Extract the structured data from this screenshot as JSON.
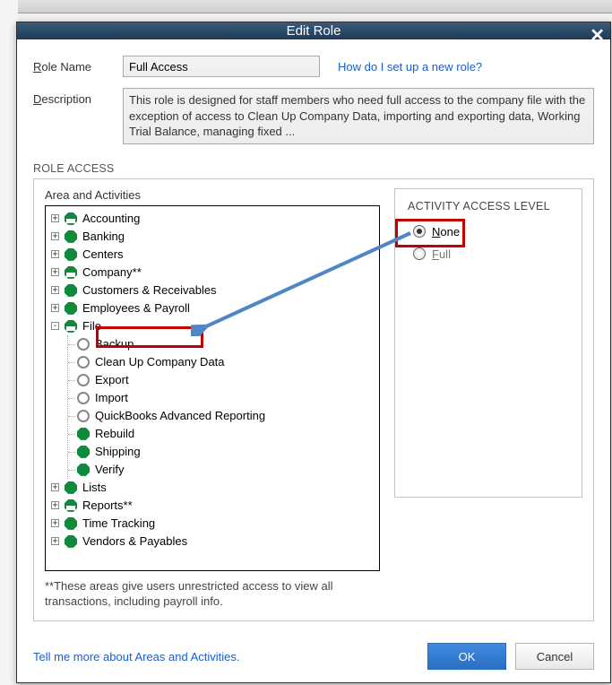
{
  "titlebar": {
    "title": "Edit Role"
  },
  "form": {
    "role_name_label": "Role Name",
    "role_name_value": "Full Access",
    "help_link": "How do I set up a new role?",
    "description_label": "Description",
    "description_value": "This role is designed for staff members who need full access to the company file with the exception of access to Clean Up Company Data, importing and exporting data, Working Trial Balance, managing fixed ..."
  },
  "access": {
    "section_label": "ROLE ACCESS",
    "area_label": "Area and Activities",
    "tree": [
      {
        "label": "Accounting",
        "icon": "partial",
        "exp": "+"
      },
      {
        "label": "Banking",
        "icon": "full",
        "exp": "+"
      },
      {
        "label": "Centers",
        "icon": "full",
        "exp": "+"
      },
      {
        "label": "Company**",
        "icon": "partial",
        "exp": "+"
      },
      {
        "label": "Customers & Receivables",
        "icon": "full",
        "exp": "+"
      },
      {
        "label": "Employees & Payroll",
        "icon": "full",
        "exp": "+"
      },
      {
        "label": "File",
        "icon": "partial",
        "exp": "-",
        "children": [
          {
            "label": "Backup",
            "icon": "empty"
          },
          {
            "label": "Clean Up Company Data",
            "icon": "empty"
          },
          {
            "label": "Export",
            "icon": "empty"
          },
          {
            "label": "Import",
            "icon": "empty"
          },
          {
            "label": "QuickBooks Advanced Reporting",
            "icon": "empty"
          },
          {
            "label": "Rebuild",
            "icon": "full"
          },
          {
            "label": "Shipping",
            "icon": "full"
          },
          {
            "label": "Verify",
            "icon": "full"
          }
        ]
      },
      {
        "label": "Lists",
        "icon": "full",
        "exp": "+"
      },
      {
        "label": "Reports**",
        "icon": "partial",
        "exp": "+"
      },
      {
        "label": "Time Tracking",
        "icon": "full",
        "exp": "+"
      },
      {
        "label": "Vendors & Payables",
        "icon": "full",
        "exp": "+"
      }
    ],
    "activity_panel_title": "ACTIVITY ACCESS LEVEL",
    "radio_none": "None",
    "radio_full": "Full",
    "note": "**These areas give users unrestricted access to view all transactions, including payroll info."
  },
  "bottom": {
    "more_link": "Tell me more about Areas and Activities.",
    "ok": "OK",
    "cancel": "Cancel"
  }
}
